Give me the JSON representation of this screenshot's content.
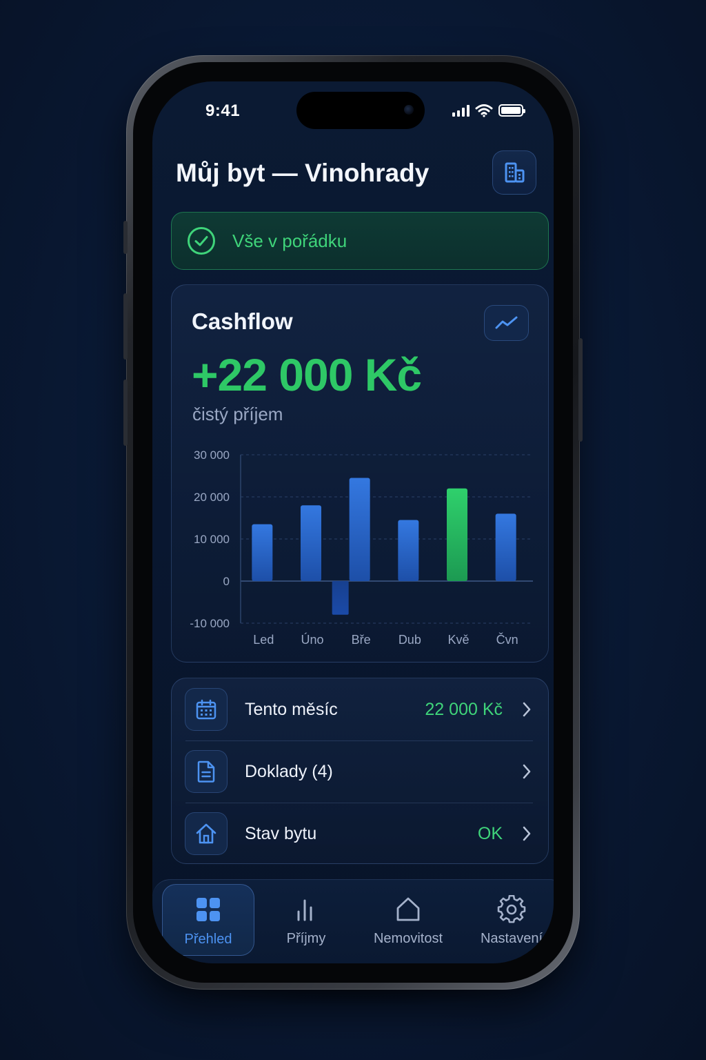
{
  "status_bar": {
    "time": "9:41"
  },
  "header": {
    "title": "Můj byt — Vinohrady",
    "building_icon": "building-icon"
  },
  "status_banner": {
    "text": "Vše v pořádku",
    "icon": "check-circle-icon",
    "color": "#3fd47a"
  },
  "cashflow": {
    "title": "Cashflow",
    "value": "+22 000 Kč",
    "subtitle": "čistý příjem",
    "trend_icon": "trend-up-icon"
  },
  "chart_data": {
    "type": "bar",
    "categories": [
      "Led",
      "Úno",
      "Bře",
      "Dub",
      "Kvě",
      "Čvn"
    ],
    "series": [
      {
        "values": [
          13500,
          18000,
          24500,
          14500,
          22000,
          16000
        ]
      },
      {
        "values": [
          0,
          0,
          -8000,
          0,
          0,
          0
        ]
      }
    ],
    "highlight_index": 4,
    "colors": {
      "bar": "#2f6fd6",
      "highlight": "#2ec866",
      "negative": "#1b4aa8"
    },
    "ylim": [
      -10000,
      30000
    ],
    "yticks": [
      30000,
      20000,
      10000,
      0,
      -10000
    ],
    "ytick_labels": [
      "30 000",
      "20 000",
      "10 000",
      "0",
      "-10 000"
    ],
    "grid": true
  },
  "list": [
    {
      "icon": "calendar-icon",
      "label": "Tento měsíc",
      "value": "22 000 Kč"
    },
    {
      "icon": "document-icon",
      "label": "Doklady (4)",
      "value": ""
    },
    {
      "icon": "house-icon",
      "label": "Stav bytu",
      "value": "OK"
    }
  ],
  "tabs": [
    {
      "label": "Přehled",
      "icon": "grid-icon",
      "active": true
    },
    {
      "label": "Příjmy",
      "icon": "bar-chart-icon",
      "active": false
    },
    {
      "label": "Nemovitost",
      "icon": "house-icon",
      "active": false
    },
    {
      "label": "Nastavení",
      "icon": "gear-icon",
      "active": false
    }
  ],
  "colors": {
    "accent": "#4d93f2",
    "positive": "#2ec866",
    "background": "#0a1a36"
  }
}
